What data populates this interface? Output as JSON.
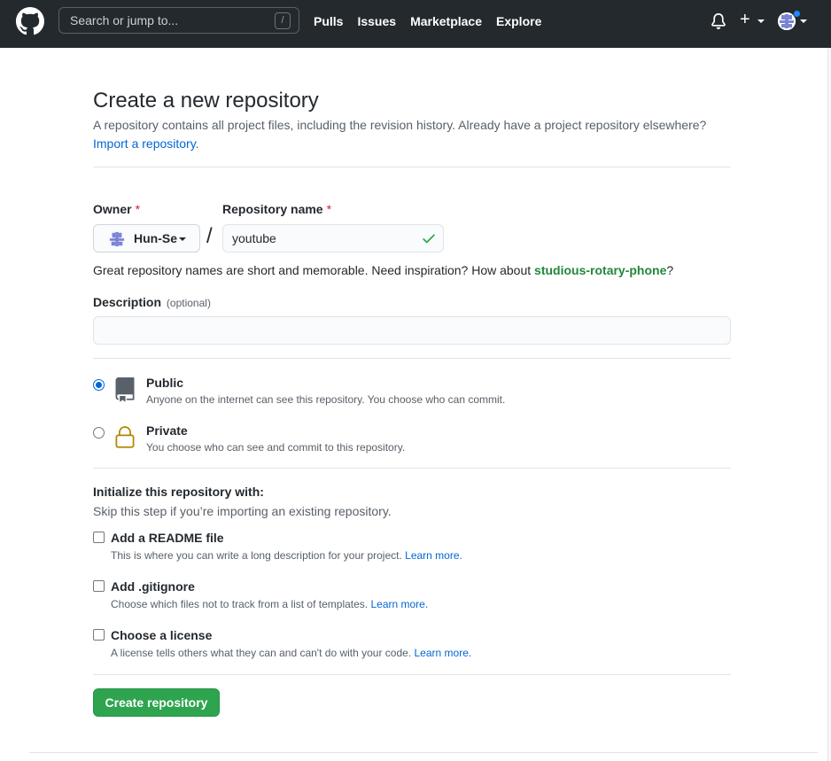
{
  "header": {
    "search_placeholder": "Search or jump to...",
    "search_shortcut": "/",
    "nav": [
      "Pulls",
      "Issues",
      "Marketplace",
      "Explore"
    ],
    "plus_symbol": "+",
    "notification_dot_color": "#2188ff"
  },
  "page": {
    "title": "Create a new repository",
    "subtitle": "A repository contains all project files, including the revision history. Already have a project repository elsewhere?",
    "import_link": "Import a repository",
    "import_period": "."
  },
  "form": {
    "owner_label": "Owner",
    "required_mark": "*",
    "owner_value": "Hun-Se",
    "separator": "/",
    "repo_name_label": "Repository name",
    "repo_name_value": "youtube",
    "hint_prefix": "Great repository names are short and memorable. Need inspiration? How about ",
    "hint_suggestion": "studious-rotary-phone",
    "hint_suffix": "?",
    "description_label": "Description",
    "description_optional": "(optional)",
    "description_value": ""
  },
  "visibility": {
    "public": {
      "title": "Public",
      "desc": "Anyone on the internet can see this repository. You choose who can commit.",
      "selected": true
    },
    "private": {
      "title": "Private",
      "desc": "You choose who can see and commit to this repository.",
      "selected": false
    }
  },
  "initialize": {
    "title": "Initialize this repository with:",
    "subtitle": "Skip this step if you’re importing an existing repository.",
    "learn_more": "Learn more.",
    "options": [
      {
        "label": "Add a README file",
        "desc": "This is where you can write a long description for your project. ",
        "checked": false
      },
      {
        "label": "Add .gitignore",
        "desc": "Choose which files not to track from a list of templates. ",
        "checked": false
      },
      {
        "label": "Choose a license",
        "desc": "A license tells others what they can and can't do with your code. ",
        "checked": false
      }
    ]
  },
  "actions": {
    "create_label": "Create repository",
    "create_color": "#2ea44f"
  }
}
